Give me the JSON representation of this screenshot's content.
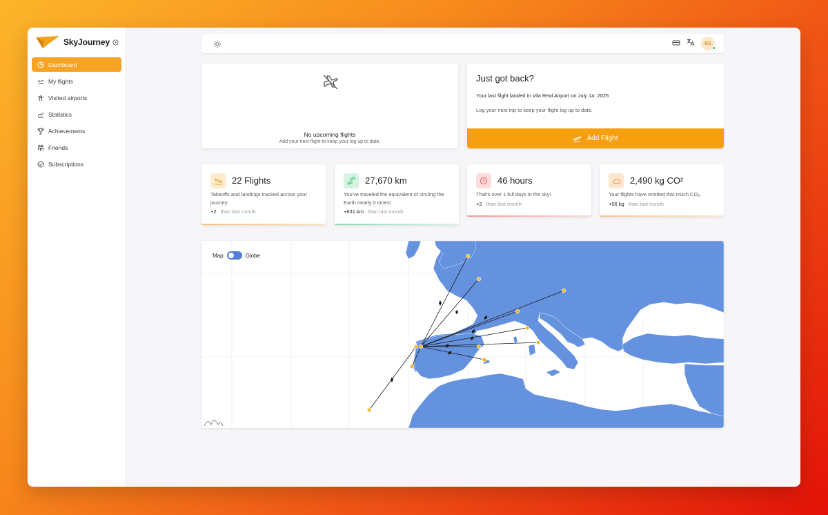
{
  "app": {
    "name": "SkyJourney"
  },
  "sidebar": {
    "items": [
      {
        "label": "Dashboard",
        "icon": "pie-chart-icon",
        "active": true
      },
      {
        "label": "My flights",
        "icon": "plane-takeoff-icon"
      },
      {
        "label": "Visited airports",
        "icon": "tower-icon"
      },
      {
        "label": "Statistics",
        "icon": "line-chart-icon"
      },
      {
        "label": "Achievements",
        "icon": "trophy-icon"
      },
      {
        "label": "Friends",
        "icon": "friends-icon"
      },
      {
        "label": "Subscriptions",
        "icon": "check-circle-icon"
      }
    ]
  },
  "topbar": {
    "avatar_initials": "RS"
  },
  "upcoming": {
    "title": "No upcoming flights",
    "subtitle": "Add your next flight to keep your log up to date."
  },
  "just_back": {
    "title": "Just got back?",
    "text1": "Your last flight landed in Vila Real Airport on July 14, 2025",
    "text2": "Log your next trip to keep your flight log up to date.",
    "button": "Add Flight"
  },
  "stats": [
    {
      "value": "22 Flights",
      "desc": "Takeoffs and landings tracked across your journey.",
      "delta": "+2",
      "delta_label": "than last month",
      "color": "#f4b24a",
      "icon": "plane-landing-icon"
    },
    {
      "value": "27,670 km",
      "desc": "You've traveled the equivalent of circling the Earth nearly 0 times!",
      "delta": "+631 km",
      "delta_label": "than last month",
      "color": "#3fbf7f",
      "icon": "route-icon"
    },
    {
      "value": "46 hours",
      "desc": "That's over 1 full days in the sky!",
      "delta": "+2",
      "delta_label": "than last month",
      "color": "#ef6a6a",
      "icon": "clock-icon"
    },
    {
      "value": "2,490 kg CO²",
      "desc": "Your flights have emitted this much CO₂.",
      "delta": "+56 kg",
      "delta_label": "than last month",
      "color": "#f6b36a",
      "icon": "cloud-icon"
    }
  ],
  "map": {
    "toggle_left": "Map",
    "toggle_right": "Globe",
    "land_color": "#6592df",
    "airport_color": "#f2b81c"
  }
}
